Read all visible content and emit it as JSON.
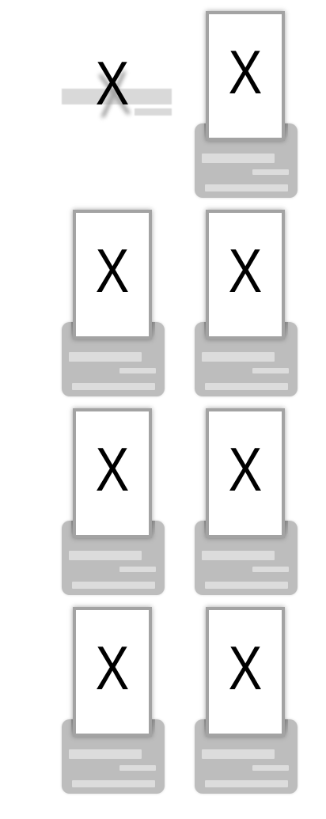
{
  "grid": {
    "items": [
      {
        "mark": "X",
        "state": "transitioning"
      },
      {
        "mark": "X",
        "state": "active"
      },
      {
        "mark": "X",
        "state": "active"
      },
      {
        "mark": "X",
        "state": "active"
      },
      {
        "mark": "X",
        "state": "active"
      },
      {
        "mark": "X",
        "state": "active"
      },
      {
        "mark": "X",
        "state": "active"
      },
      {
        "mark": "X",
        "state": "active"
      }
    ]
  },
  "colors": {
    "background": "#ffffff",
    "tray": "#bdbdbd",
    "tray_bar": "#dcdcdc",
    "card_border": "#a3a3a3",
    "mark": "#000000"
  }
}
